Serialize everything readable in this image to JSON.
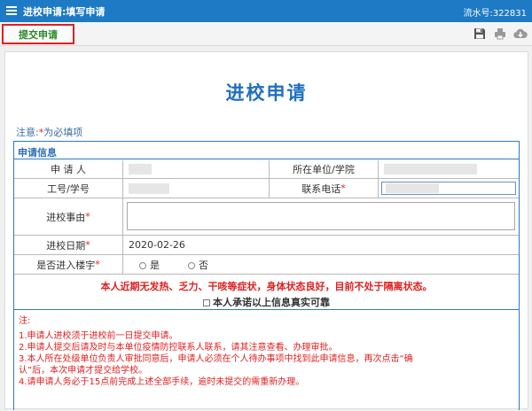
{
  "header": {
    "title": "进校申请:填写申请",
    "serial": "流水号:322831"
  },
  "toolbar": {
    "submit_label": "提交申请",
    "icons": [
      "save-icon",
      "print-icon",
      "download-icon"
    ]
  },
  "form": {
    "title": "进校申请",
    "note_prefix": "注意:",
    "note_star": "*",
    "note_suffix": "为必填项",
    "section": "申请信息",
    "applicant_label": "申 请 人",
    "unit_label": "所在单位/学院",
    "id_label": "工号/学号",
    "phone_label": "联系电话",
    "reason_label": "进校事由",
    "date_label": "进校日期",
    "date_value": "2020-02-26",
    "building_label": "是否进入楼宇",
    "option_yes": "是",
    "option_no": "否",
    "required_star": "*",
    "declaration": "本人近期无发热、乏力、干咳等症状，身体状态良好，目前不处于隔离状态。",
    "promise": "本人承诺以上信息真实可靠",
    "notes_title": "注:",
    "notes": [
      "1.申请人进校须于进校前一日提交申请。",
      "2.申请人提交后请及时与本单位疫情防控联系人联系，请其注意查看、办理审批。",
      "3.本人所在处级单位负责人审批同意后，申请人必须在个人待办事项中找到此申请信息，再次点击“确",
      "认”后，本次申请才提交给学校。",
      "4.请申请人务必于15点前完成上述全部手续，逾时未提交的需重新办理。"
    ]
  },
  "colors": {
    "header": "#1e7ac4",
    "title": "#1e6fbf",
    "border": "#2e7bc0",
    "required": "#e02020",
    "submit_text": "#2a8a2a"
  }
}
